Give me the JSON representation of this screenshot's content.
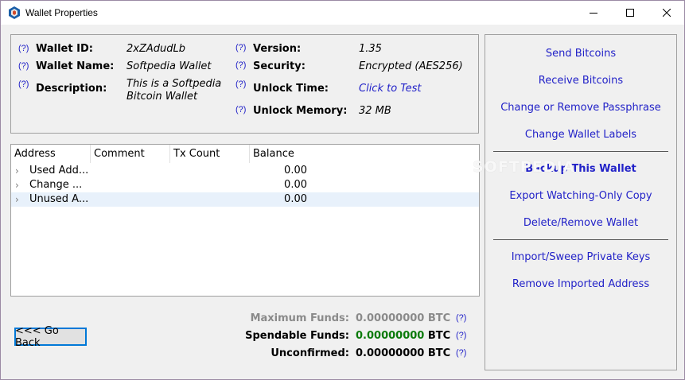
{
  "window": {
    "title": "Wallet Properties"
  },
  "info": {
    "help": "(?)",
    "wallet_id_label": "Wallet ID:",
    "wallet_id_value": "2xZAdudLb",
    "wallet_name_label": "Wallet Name:",
    "wallet_name_value": "Softpedia Wallet",
    "description_label": "Description:",
    "description_line1": "This is a Softpedia",
    "description_line2": "Bitcoin Wallet",
    "version_label": "Version:",
    "version_value": "1.35",
    "security_label": "Security:",
    "security_value": "Encrypted (AES256)",
    "unlock_time_label": "Unlock Time:",
    "unlock_time_value": "Click to Test",
    "unlock_memory_label": "Unlock Memory:",
    "unlock_memory_value": "32 MB"
  },
  "tree": {
    "columns": [
      "Address",
      "Comment",
      "Tx Count",
      "Balance"
    ],
    "rows": [
      {
        "name": "Used Add...",
        "balance": "0.00"
      },
      {
        "name": "Change ...",
        "balance": "0.00"
      },
      {
        "name": "Unused A...",
        "balance": "0.00"
      }
    ]
  },
  "buttons": {
    "go_back": "<<< Go Back"
  },
  "funds": {
    "max_label": "Maximum Funds:",
    "max_value": "0.00000000 BTC",
    "spendable_label": "Spendable Funds:",
    "spendable_value": "0.00000000",
    "unconfirmed_label": "Unconfirmed:",
    "unconfirmed_value": "0.00000000 BTC",
    "btc": "BTC",
    "help": "(?)",
    "spendable_color": "#0a7a0a"
  },
  "actions": {
    "send": "Send Bitcoins",
    "receive": "Receive Bitcoins",
    "passphrase": "Change or Remove Passphrase",
    "labels": "Change Wallet Labels",
    "backup": "Backup This Wallet",
    "export": "Export Watching-Only Copy",
    "delete": "Delete/Remove Wallet",
    "import": "Import/Sweep Private Keys",
    "remove_imported": "Remove Imported Address"
  },
  "watermark": "SOFTPEDIA",
  "colors": {
    "link": "#2222c8",
    "accent": "#0078d7"
  }
}
